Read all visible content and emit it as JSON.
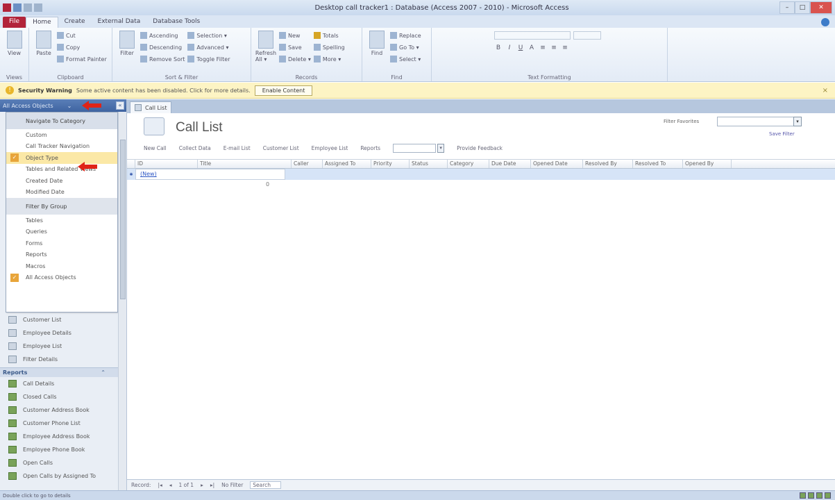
{
  "window": {
    "title": "Desktop call tracker1 : Database (Access 2007 - 2010) - Microsoft Access",
    "controls": [
      "–",
      "□",
      "✕"
    ]
  },
  "ribbon_tabs": [
    "File",
    "Home",
    "Create",
    "External Data",
    "Database Tools"
  ],
  "ribbon": {
    "views": {
      "label": "View",
      "group": "Views"
    },
    "clipboard": {
      "paste": "Paste",
      "cut": "Cut",
      "copy": "Copy",
      "format_painter": "Format Painter",
      "group": "Clipboard"
    },
    "sort_filter": {
      "filter": "Filter",
      "ascending": "Ascending",
      "descending": "Descending",
      "remove_sort": "Remove Sort",
      "selection": "Selection ▾",
      "advanced": "Advanced ▾",
      "toggle_filter": "Toggle Filter",
      "group": "Sort & Filter"
    },
    "records": {
      "refresh": "Refresh All ▾",
      "new": "New",
      "save": "Save",
      "delete": "Delete ▾",
      "totals": "Totals",
      "spelling": "Spelling",
      "more": "More ▾",
      "group": "Records"
    },
    "find": {
      "find": "Find",
      "replace": "Replace",
      "goto": "Go To ▾",
      "select": "Select ▾",
      "group": "Find"
    },
    "text_formatting": {
      "group": "Text Formatting"
    }
  },
  "security_bar": {
    "title": "Security Warning",
    "message": "Some active content has been disabled. Click for more details.",
    "button": "Enable Content",
    "close": "×"
  },
  "nav_pane": {
    "header": "All Access Objects",
    "caret": "⌄",
    "collapse": "«",
    "dropdown": [
      {
        "label": "Navigate To Category",
        "type": "header"
      },
      {
        "label": "Custom"
      },
      {
        "label": "Call Tracker Navigation"
      },
      {
        "label": "Object Type",
        "checked": true,
        "selected": true
      },
      {
        "label": "Tables and Related Views"
      },
      {
        "label": "Created Date"
      },
      {
        "label": "Modified Date"
      },
      {
        "label": "Filter By Group",
        "type": "header"
      },
      {
        "label": "Tables"
      },
      {
        "label": "Queries"
      },
      {
        "label": "Forms"
      },
      {
        "label": "Reports"
      },
      {
        "label": "Macros"
      },
      {
        "label": "All Access Objects",
        "checked": true
      }
    ],
    "forms": [
      "Customer List",
      "Employee Details",
      "Employee List",
      "Filter Details"
    ],
    "reports_header": "Reports",
    "reports_chevron": "⌃",
    "reports": [
      "Call Details",
      "Closed Calls",
      "Customer Address Book",
      "Customer Phone List",
      "Employee Address Book",
      "Employee Phone Book",
      "Open Calls",
      "Open Calls by Assigned To"
    ]
  },
  "document": {
    "tab_label": "Call List",
    "form_title": "Call List",
    "filter_label": "Filter Favorites",
    "save_filter": "Save Filter",
    "actions": [
      "New Call",
      "Collect Data",
      "E-mail List",
      "Customer List",
      "Employee List",
      "Reports"
    ],
    "feedback": "Provide Feedback",
    "columns": [
      "ID",
      "Title",
      "Caller",
      "Assigned To",
      "Priority",
      "Status",
      "Category",
      "Due Date",
      "Opened Date",
      "Resolved By",
      "Resolved To",
      "Opened By"
    ],
    "new_row_label": "(New)",
    "total_marker": "0"
  },
  "record_nav": {
    "record_label": "Record: ",
    "position": "1 of 1",
    "filter": "No Filter",
    "search": "Search"
  },
  "status_bar": {
    "text": "Double click to go to details"
  },
  "colors": {
    "file_tab": "#b2243a",
    "nav_header": "#3f64a1",
    "security_bar": "#fdf4c4",
    "selected_row": "#d6e4f7",
    "red_arrow": "#e02418"
  }
}
